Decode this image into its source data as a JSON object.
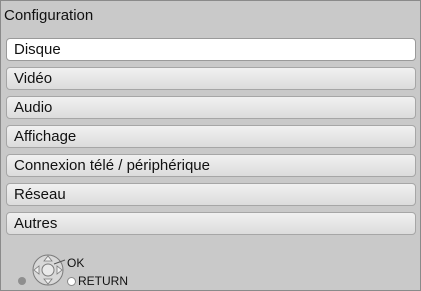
{
  "window": {
    "title": "Configuration"
  },
  "menu": {
    "items": [
      {
        "label": "Disque",
        "selected": true
      },
      {
        "label": "Vidéo",
        "selected": false
      },
      {
        "label": "Audio",
        "selected": false
      },
      {
        "label": "Affichage",
        "selected": false
      },
      {
        "label": "Connexion télé / périphérique",
        "selected": false
      },
      {
        "label": "Réseau",
        "selected": false
      },
      {
        "label": "Autres",
        "selected": false
      }
    ]
  },
  "footer": {
    "ok_label": "OK",
    "return_label": "RETURN",
    "icons": [
      "dpad-icon",
      "return-dot-icon"
    ]
  },
  "colors": {
    "background": "#c9c9c9",
    "item": "#e6e6e6",
    "selected_item": "#ffffff",
    "text": "#111111"
  }
}
